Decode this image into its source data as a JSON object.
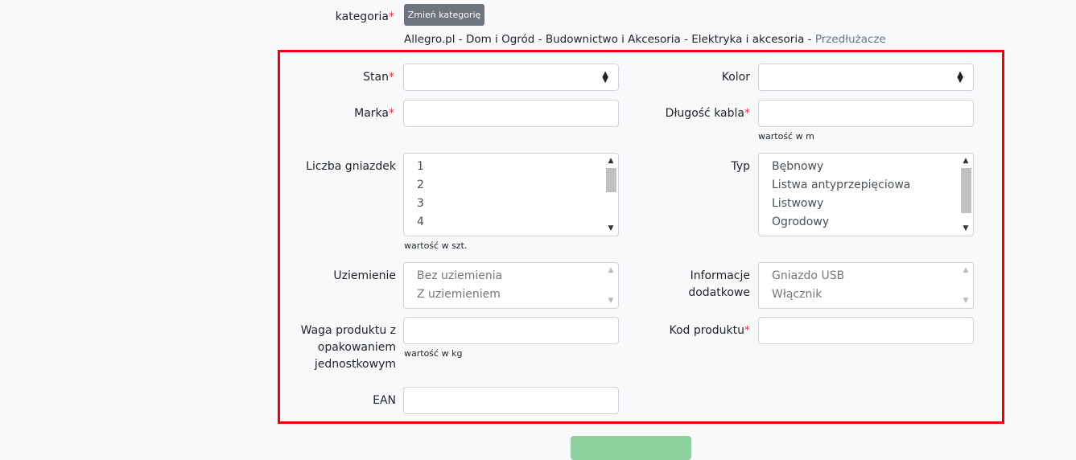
{
  "category": {
    "label": "kategoria",
    "change_button": "Zmień kategorię",
    "path_prefix": "Allegro.pl - Dom i Ogród - Budownictwo i Akcesoria - Elektryka i akcesoria - ",
    "path_last": "Przedłużacze"
  },
  "required_mark": "*",
  "fields": {
    "stan": {
      "label": "Stan",
      "value": ""
    },
    "kolor": {
      "label": "Kolor",
      "value": ""
    },
    "marka": {
      "label": "Marka",
      "value": ""
    },
    "dlugosc": {
      "label": "Długość kabla",
      "value": "",
      "hint": "wartość w m"
    },
    "liczba": {
      "label": "Liczba gniazdek",
      "hint": "wartość w szt.",
      "options": [
        "1",
        "2",
        "3",
        "4"
      ]
    },
    "typ": {
      "label": "Typ",
      "options": [
        "Bębnowy",
        "Listwa antyprzepięciowa",
        "Listwowy",
        "Ogrodowy"
      ]
    },
    "uziemienie": {
      "label": "Uziemienie",
      "options": [
        "Bez uziemienia",
        "Z uziemieniem"
      ]
    },
    "info": {
      "label_line1": "Informacje",
      "label_line2": "dodatkowe",
      "options": [
        "Gniazdo USB",
        "Włącznik"
      ]
    },
    "waga": {
      "label_line1": "Waga produktu z",
      "label_line2": "opakowaniem",
      "label_line3": "jednostkowym",
      "value": "",
      "hint": "wartość w kg"
    },
    "kod": {
      "label": "Kod produktu",
      "value": ""
    },
    "ean": {
      "label": "EAN",
      "value": ""
    }
  },
  "colors": {
    "highlight_border": "#e8000b",
    "button_gray": "#6c757d",
    "submit_green": "#8fd19e",
    "required": "#dc3545"
  }
}
